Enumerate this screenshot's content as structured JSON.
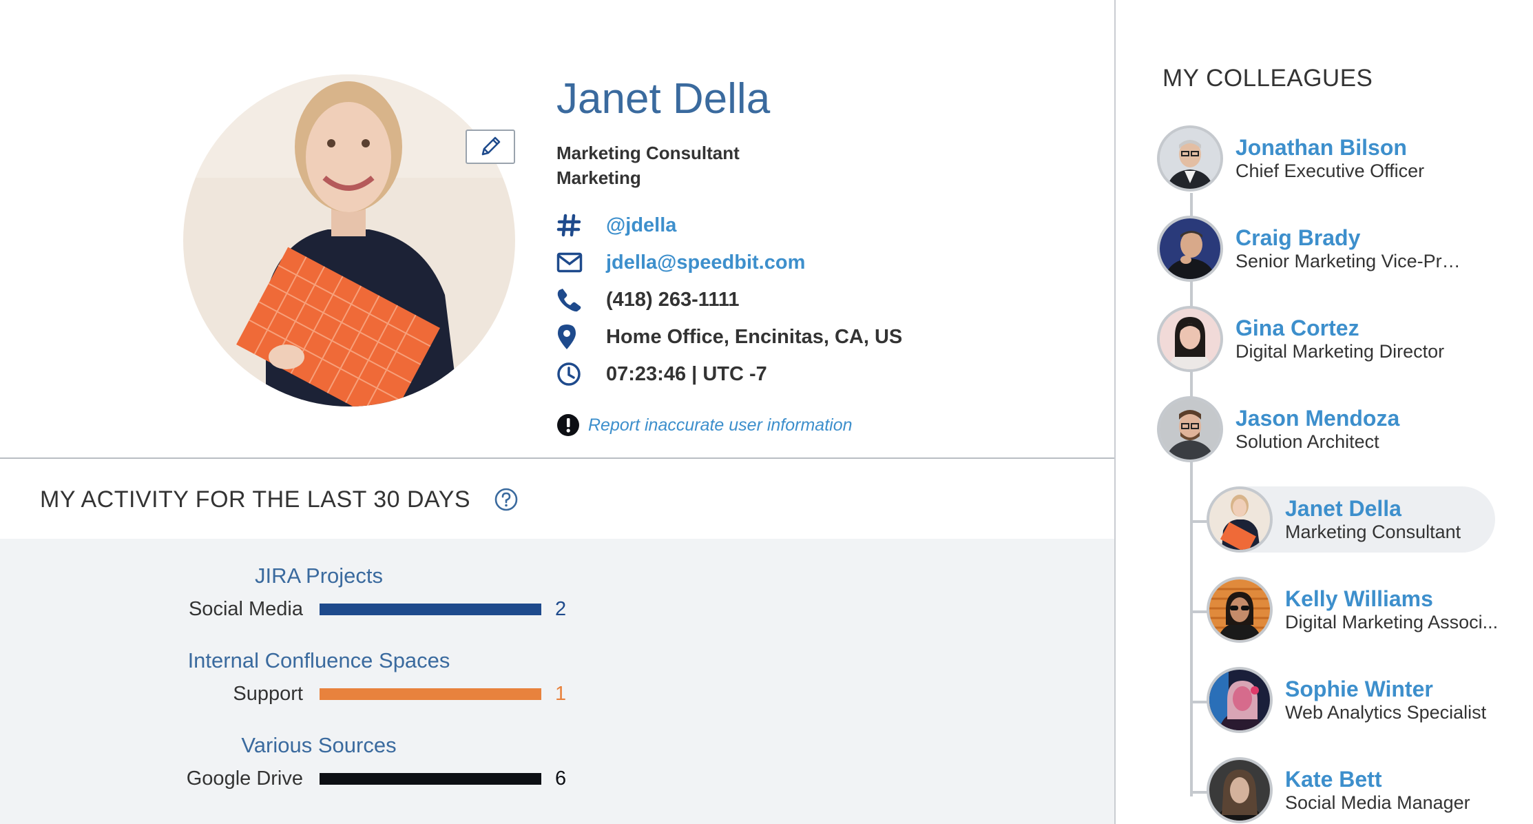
{
  "profile": {
    "name": "Janet Della",
    "job_title": "Marketing Consultant",
    "department": "Marketing",
    "contacts": [
      {
        "icon": "hashtag-icon",
        "text": "@jdella",
        "link": true
      },
      {
        "icon": "envelope-icon",
        "text": "jdella@speedbit.com",
        "link": true
      },
      {
        "icon": "phone-icon",
        "text": "(418) 263-1111",
        "link": false
      },
      {
        "icon": "location-pin-icon",
        "text": "Home Office, Encinitas, CA, US",
        "link": false
      },
      {
        "icon": "clock-icon",
        "text": "07:23:46 | UTC -7",
        "link": false
      }
    ],
    "report_link": "Report inaccurate user information"
  },
  "activity": {
    "title": "MY ACTIVITY FOR THE LAST 30 DAYS",
    "groups": [
      {
        "title": "JIRA Projects",
        "label": "Social Media",
        "value": "2",
        "color": "#1e4a8c"
      },
      {
        "title": "Internal Confluence Spaces",
        "label": "Support",
        "value": "1",
        "color": "#e8823d"
      },
      {
        "title": "Various Sources",
        "label": "Google Drive",
        "value": "6",
        "color": "#0d0f14"
      }
    ]
  },
  "colleagues": {
    "title": "MY COLLEAGUES",
    "items": [
      {
        "name": "Jonathan Bilson",
        "title": "Chief Executive Officer"
      },
      {
        "name": "Craig Brady",
        "title": "Senior Marketing Vice-Presid..."
      },
      {
        "name": "Gina Cortez",
        "title": "Digital Marketing Director"
      },
      {
        "name": "Jason Mendoza",
        "title": "Solution Architect"
      },
      {
        "name": "Janet Della",
        "title": "Marketing Consultant"
      },
      {
        "name": "Kelly Williams",
        "title": "Digital Marketing Associ..."
      },
      {
        "name": "Sophie Winter",
        "title": "Web Analytics Specialist"
      },
      {
        "name": "Kate Bett",
        "title": "Social Media Manager"
      }
    ]
  },
  "colors": {
    "accent": "#3d8fcc",
    "heading": "#3a6a9e",
    "panel": "#f1f3f5"
  }
}
